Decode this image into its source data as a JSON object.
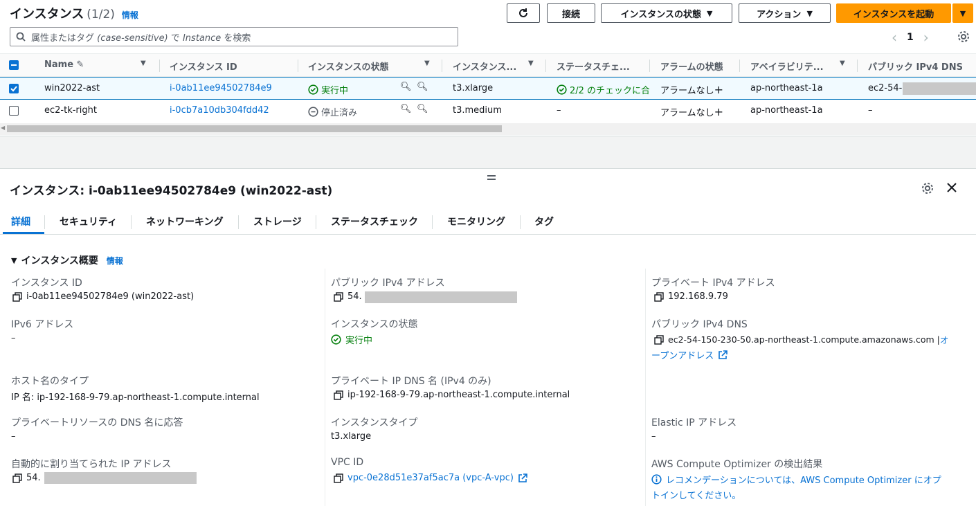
{
  "header": {
    "title": "インスタンス",
    "count": "(1/2)",
    "info": "情報",
    "connect": "接続",
    "instance_state": "インスタンスの状態",
    "actions": "アクション",
    "launch": "インスタンスを起動"
  },
  "search": {
    "placeholder_prefix": "属性またはタグ",
    "placeholder_italic": "(case-sensitive)",
    "placeholder_mid": "で",
    "placeholder_italic2": "Instance",
    "placeholder_suffix": "を検索"
  },
  "pager": {
    "page": "1"
  },
  "table": {
    "columns": [
      "Name",
      "インスタンス ID",
      "インスタンスの状態",
      "インスタンス...",
      "ステータスチェ...",
      "アラームの状態",
      "アベイラビリテ...",
      "パブリック IPv4 DNS"
    ],
    "rows": [
      {
        "selected": true,
        "name": "win2022-ast",
        "id": "i-0ab11ee94502784e9",
        "state": "実行中",
        "type": "t3.xlarge",
        "status": "2/2 のチェックに合",
        "alarm": "アラームなし",
        "az": "ap-northeast-1a",
        "dns": "ec2-54-"
      },
      {
        "selected": false,
        "name": "ec2-tk-right",
        "id": "i-0cb7a10db304fdd42",
        "state": "停止済み",
        "type": "t3.medium",
        "status": "–",
        "alarm": "アラームなし",
        "az": "ap-northeast-1a",
        "dns": "–"
      }
    ]
  },
  "detail": {
    "title": "インスタンス: i-0ab11ee94502784e9 (win2022-ast)",
    "tabs": [
      "詳細",
      "セキュリティ",
      "ネットワーキング",
      "ストレージ",
      "ステータスチェック",
      "モニタリング",
      "タグ"
    ],
    "section": "インスタンス概要",
    "section_info": "情報",
    "fields": {
      "instance_id_label": "インスタンス ID",
      "instance_id": "i-0ab11ee94502784e9 (win2022-ast)",
      "public_ipv4_label": "パブリック IPv4 アドレス",
      "public_ipv4": "54.",
      "private_ipv4_label": "プライベート IPv4 アドレス",
      "private_ipv4": "192.168.9.79",
      "ipv6_label": "IPv6 アドレス",
      "ipv6": "–",
      "state_label": "インスタンスの状態",
      "state": "実行中",
      "public_dns_label": "パブリック IPv4 DNS",
      "public_dns": "ec2-54-150-230-50.ap-northeast-1.compute.amazonaws.com |",
      "public_dns_link1": "オ",
      "public_dns_link2": "ープンアドレス",
      "hostname_type_label": "ホスト名のタイプ",
      "hostname_type": "IP 名: ip-192-168-9-79.ap-northeast-1.compute.internal",
      "private_dns_label": "プライベート IP DNS 名 (IPv4 のみ)",
      "private_dns": "ip-192-168-9-79.ap-northeast-1.compute.internal",
      "answer_dns_label": "プライベートリソースの DNS 名に応答",
      "answer_dns": "–",
      "instance_type_label": "インスタンスタイプ",
      "instance_type": "t3.xlarge",
      "elastic_ip_label": "Elastic IP アドレス",
      "elastic_ip": "–",
      "auto_ip_label": "自動的に割り当てられた IP アドレス",
      "auto_ip": "54.",
      "vpc_label": "VPC ID",
      "vpc": "vpc-0e28d51e37af5ac7a (vpc-A-vpc)",
      "optimizer_label": "AWS Compute Optimizer の検出結果",
      "optimizer_line1": "レコメンデーションについては、AWS Compute Optimizer にオプ",
      "optimizer_line2": "トインしてください。"
    }
  },
  "colors": {
    "accent": "#0972d3",
    "primary": "#ff9900",
    "success": "#037f0c"
  }
}
